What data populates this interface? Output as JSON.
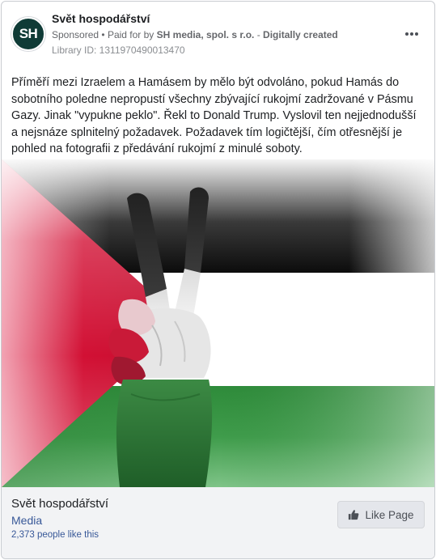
{
  "post": {
    "page_name": "Svět hospodářství",
    "avatar_initials": "SH",
    "sponsored_label": "Sponsored",
    "separator": "•",
    "paid_for_prefix": "Paid for by",
    "paid_for_by": "SH media, spol. s r.o.",
    "dash": "-",
    "created_label": "Digitally created",
    "library_id": "Library ID: 1311970490013470",
    "more_icon": "more-options-icon",
    "text": "Příměří mezi Izraelem a Hamásem by mělo být odvoláno, pokud Hamás do sobotního poledne nepropustí všechny zbývající rukojmí zadržované v Pásmu Gazy. Jinak \"vypukne peklo\". Řekl to Donald Trump. Vyslovil ten nejjednodušší a nejsnáze splnitelný požadavek. Požadavek tím logičtější, čím otřesnější je pohled na fotografii z předávání rukojmí z minulé soboty."
  },
  "footer": {
    "page_name": "Svět hospodářství",
    "category": "Media",
    "likes": "2,373 people like this",
    "like_button_label": "Like Page",
    "like_icon": "thumbs-up-icon"
  },
  "colors": {
    "avatar_bg": "#0f3b36",
    "link": "#385898",
    "flag_red": "#d21034",
    "flag_green": "#2e8b3a",
    "flag_black": "#111111"
  }
}
